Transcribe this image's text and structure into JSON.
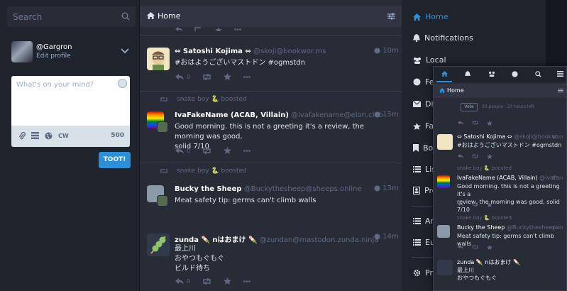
{
  "search": {
    "placeholder": "Search"
  },
  "account": {
    "name": "@Gargron",
    "edit_label": "Edit profile"
  },
  "compose": {
    "placeholder": "What's on your mind?",
    "cw_label": "CW",
    "char_count": "500",
    "toot_label": "TOOT!"
  },
  "home": {
    "title": "Home"
  },
  "statuses": [
    {
      "display_name": "⇔ Satoshi Kojima ⇔",
      "handle": "@skoji@bookwor.ms",
      "time": "10m",
      "content": [
        "#おはようございマストドン #ogmstdn"
      ],
      "reply_count": "0",
      "boosted_by": ""
    },
    {
      "display_name": "IvaFakeName (ACAB, Villain)",
      "handle": "@ivafakename@elon.club",
      "time": "15m",
      "content": [
        "Good morning. this is not a greeting it's a review, the morning was good,",
        "solid 7/10"
      ],
      "reply_count": "0",
      "boosted_by": "snake boy 🐍 boosted"
    },
    {
      "display_name": "Bucky the Sheep",
      "handle": "@Buckythesheep@sheeps.online",
      "time": "13m",
      "content": [
        "Meat safety tip: germs can't climb walls"
      ],
      "reply_count": "0",
      "boosted_by": "snake boy 🐍 boosted"
    },
    {
      "display_name": "zunda 🍡 nはおまけ 🍡",
      "handle": "@zundan@mastodon.zunda.ninja",
      "time": "14m",
      "content": [
        "最上川",
        "おやつもぐもぐ",
        "ビルド待ち"
      ],
      "reply_count": "0",
      "boosted_by": ""
    }
  ],
  "nav": [
    {
      "label": "Home",
      "icon": "home-icon",
      "active": true
    },
    {
      "label": "Notifications",
      "icon": "bell-icon"
    },
    {
      "label": "Local",
      "icon": "users-icon"
    },
    {
      "label": "Fe",
      "icon": "globe-icon"
    },
    {
      "label": "Di",
      "icon": "envelope-icon"
    },
    {
      "label": "Fa",
      "icon": "star-icon"
    },
    {
      "label": "Bo",
      "icon": "bookmark-icon"
    },
    {
      "label": "Lis",
      "icon": "list-icon"
    },
    {
      "label": "Pro",
      "icon": "profile-icon"
    },
    {
      "label": "Art",
      "icon": "list-icon"
    },
    {
      "label": "Eu",
      "icon": "list-icon"
    },
    {
      "label": "Pre",
      "icon": "gear-icon"
    }
  ],
  "mobile": {
    "home_title": "Home",
    "vote_label": "Vote",
    "poll_info": "30 people · 23 hours left",
    "statuses": [
      {
        "display_name": "⇔ Satoshi Kojima ⇔",
        "handle": "@skoji@bookw...",
        "time": "12m",
        "content": [
          "#おはようございマストドン #ogmstdn"
        ]
      },
      {
        "boost": "snake boy 🐍 boosted",
        "display_name": "IvaFakeName (ACAB, Villain)",
        "handle": "@ivaf...",
        "time": "16m",
        "content": [
          "Good morning. this is not a greeting it's a",
          "review, the morning was good, solid 7/10"
        ]
      },
      {
        "boost": "snake boy 🐍 boosted",
        "display_name": "Bucky the Sheep",
        "handle": "@Buckythesheep...",
        "time": "13m",
        "content": [
          "Meat safety tip: germs can't climb walls"
        ]
      },
      {
        "display_name": "zunda 🍡 nはおまけ 🍡",
        "handle": "",
        "time": "",
        "content": [
          "最上川",
          "おやつもぐもぐ"
        ]
      }
    ]
  },
  "colors": {
    "accent": "#2b90d9",
    "background": "#15181f",
    "column": "#282c37"
  }
}
